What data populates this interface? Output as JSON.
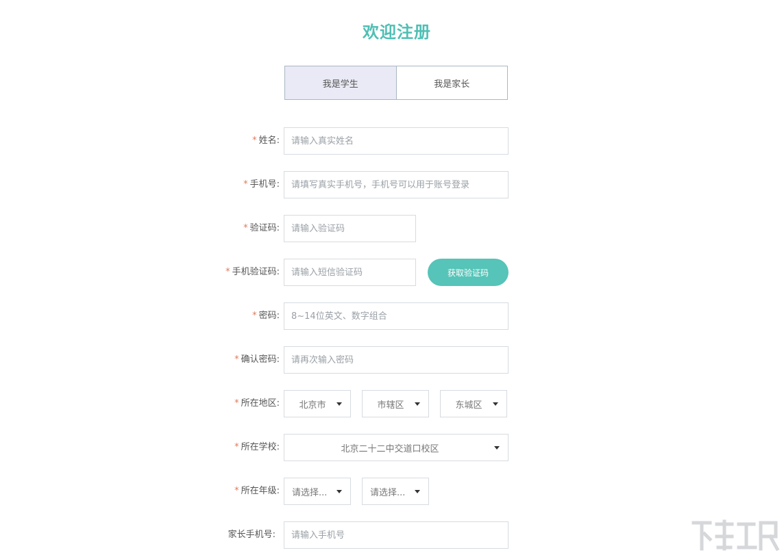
{
  "title": "欢迎注册",
  "tabs": [
    {
      "label": "我是学生",
      "active": true
    },
    {
      "label": "我是家长",
      "active": false
    }
  ],
  "form": {
    "name": {
      "label": "姓名:",
      "required": true,
      "placeholder": "请输入真实姓名"
    },
    "phone": {
      "label": "手机号:",
      "required": true,
      "placeholder": "请填写真实手机号，手机号可以用于账号登录"
    },
    "captcha": {
      "label": "验证码:",
      "required": true,
      "placeholder": "请输入验证码"
    },
    "sms_code": {
      "label": "手机验证码:",
      "required": true,
      "placeholder": "请输入短信验证码",
      "button_label": "获取验证码"
    },
    "password": {
      "label": "密码:",
      "required": true,
      "placeholder": "8~14位英文、数字组合"
    },
    "confirm_password": {
      "label": "确认密码:",
      "required": true,
      "placeholder": "请再次输入密码"
    },
    "region": {
      "label": "所在地区:",
      "required": true,
      "city": "北京市",
      "district": "市辖区",
      "area": "东城区"
    },
    "school": {
      "label": "所在学校:",
      "required": true,
      "value": "北京二十二中交道口校区"
    },
    "grade": {
      "label": "所在年级:",
      "required": true,
      "grade_value": "请选择...",
      "class_value": "请选择..."
    },
    "parent_phone": {
      "label": "家长手机号:",
      "required": false,
      "placeholder": "请输入手机号"
    }
  },
  "required_mark": "*",
  "colors": {
    "accent": "#4fbfb4",
    "button": "#56c4b8",
    "required": "#e07a5a",
    "active_tab": "#e9eaf5"
  }
}
